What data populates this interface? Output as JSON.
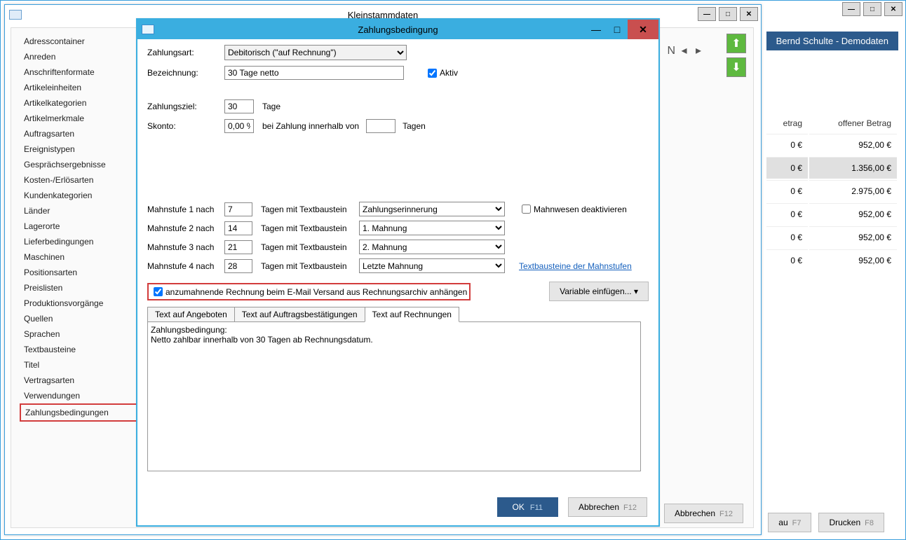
{
  "back": {
    "header": "Bernd Schulte - Demodaten",
    "columns": {
      "c1": "etrag",
      "c2": "offener Betrag"
    },
    "rows": [
      {
        "c1": "0 €",
        "c2": "952,00 €",
        "sel": false
      },
      {
        "c1": "0 €",
        "c2": "1.356,00 €",
        "sel": true
      },
      {
        "c1": "0 €",
        "c2": "2.975,00 €",
        "sel": false
      },
      {
        "c1": "0 €",
        "c2": "952,00 €",
        "sel": false
      },
      {
        "c1": "0 €",
        "c2": "952,00 €",
        "sel": false
      },
      {
        "c1": "0 €",
        "c2": "952,00 €",
        "sel": false
      }
    ],
    "btn_au": "au",
    "btn_au_key": "F7",
    "btn_print": "Drucken",
    "btn_print_key": "F8"
  },
  "kl": {
    "title": "Kleinstammdaten",
    "items": [
      "Adresscontainer",
      "Anreden",
      "Anschriftenformate",
      "Artikeleinheiten",
      "Artikelkategorien",
      "Artikelmerkmale",
      "Auftragsarten",
      "Ereignistypen",
      "Gesprächsergebnisse",
      "Kosten-/Erlösarten",
      "Kundenkategorien",
      "Länder",
      "Lagerorte",
      "Lieferbedingungen",
      "Maschinen",
      "Positionsarten",
      "Preislisten",
      "Produktionsvorgänge",
      "Quellen",
      "Sprachen",
      "Textbausteine",
      "Titel",
      "Vertragsarten",
      "Verwendungen",
      "Zahlungsbedingungen"
    ],
    "hl_index": 24,
    "abbr": "Abbrechen",
    "abbr_key": "F12",
    "n_label": "N"
  },
  "dlg": {
    "title": "Zahlungsbedingung",
    "zahlungsart_lbl": "Zahlungsart:",
    "zahlungsart_val": "Debitorisch (\"auf Rechnung\")",
    "bezeichnung_lbl": "Bezeichnung:",
    "bezeichnung_val": "30 Tage netto",
    "aktiv_lbl": "Aktiv",
    "zahlungsziel_lbl": "Zahlungsziel:",
    "zahlungsziel_val": "30",
    "tage_lbl": "Tage",
    "skonto_lbl": "Skonto:",
    "skonto_val": "0,00 %",
    "skonto_mid": "bei Zahlung innerhalb von",
    "skonto_days": "",
    "tagen_lbl": "Tagen",
    "mahn_lbl": "Mahnstufe",
    "nach_lbl": "nach",
    "tagen_mit_lbl": "Tagen mit Textbaustein",
    "mahn": [
      {
        "n": "1",
        "days": "7",
        "tb": "Zahlungserinnerung"
      },
      {
        "n": "2",
        "days": "14",
        "tb": "1. Mahnung"
      },
      {
        "n": "3",
        "days": "21",
        "tb": "2. Mahnung"
      },
      {
        "n": "4",
        "days": "28",
        "tb": "Letzte Mahnung"
      }
    ],
    "mahnwesen_deakt": "Mahnwesen deaktivieren",
    "textbausteine_link": "Textbausteine der Mahnstufen",
    "anhang_chk": "anzumahnende Rechnung beim E-Mail Versand aus Rechnungsarchiv anhängen",
    "variable_btn": "Variable einfügen...",
    "tabs": [
      "Text auf Angeboten",
      "Text auf Auftragsbestätigungen",
      "Text auf Rechnungen"
    ],
    "active_tab": 2,
    "text": "Zahlungsbedingung:\nNetto zahlbar innerhalb von 30 Tagen ab Rechnungsdatum.",
    "ok": "OK",
    "ok_key": "F11",
    "cancel": "Abbrechen",
    "cancel_key": "F12"
  }
}
